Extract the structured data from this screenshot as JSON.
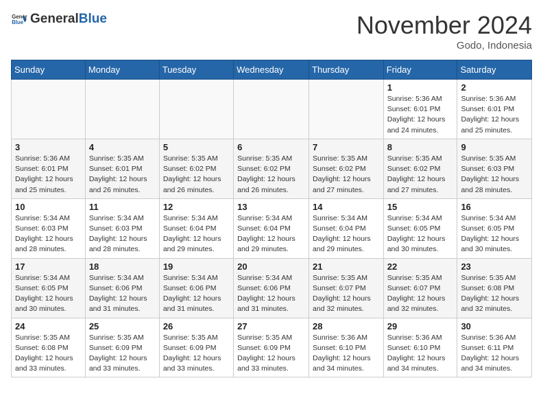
{
  "header": {
    "logo_general": "General",
    "logo_blue": "Blue",
    "month_title": "November 2024",
    "location": "Godo, Indonesia"
  },
  "weekdays": [
    "Sunday",
    "Monday",
    "Tuesday",
    "Wednesday",
    "Thursday",
    "Friday",
    "Saturday"
  ],
  "weeks": [
    [
      {
        "day": "",
        "info": ""
      },
      {
        "day": "",
        "info": ""
      },
      {
        "day": "",
        "info": ""
      },
      {
        "day": "",
        "info": ""
      },
      {
        "day": "",
        "info": ""
      },
      {
        "day": "1",
        "info": "Sunrise: 5:36 AM\nSunset: 6:01 PM\nDaylight: 12 hours and 24 minutes."
      },
      {
        "day": "2",
        "info": "Sunrise: 5:36 AM\nSunset: 6:01 PM\nDaylight: 12 hours and 25 minutes."
      }
    ],
    [
      {
        "day": "3",
        "info": "Sunrise: 5:36 AM\nSunset: 6:01 PM\nDaylight: 12 hours and 25 minutes."
      },
      {
        "day": "4",
        "info": "Sunrise: 5:35 AM\nSunset: 6:01 PM\nDaylight: 12 hours and 26 minutes."
      },
      {
        "day": "5",
        "info": "Sunrise: 5:35 AM\nSunset: 6:02 PM\nDaylight: 12 hours and 26 minutes."
      },
      {
        "day": "6",
        "info": "Sunrise: 5:35 AM\nSunset: 6:02 PM\nDaylight: 12 hours and 26 minutes."
      },
      {
        "day": "7",
        "info": "Sunrise: 5:35 AM\nSunset: 6:02 PM\nDaylight: 12 hours and 27 minutes."
      },
      {
        "day": "8",
        "info": "Sunrise: 5:35 AM\nSunset: 6:02 PM\nDaylight: 12 hours and 27 minutes."
      },
      {
        "day": "9",
        "info": "Sunrise: 5:35 AM\nSunset: 6:03 PM\nDaylight: 12 hours and 28 minutes."
      }
    ],
    [
      {
        "day": "10",
        "info": "Sunrise: 5:34 AM\nSunset: 6:03 PM\nDaylight: 12 hours and 28 minutes."
      },
      {
        "day": "11",
        "info": "Sunrise: 5:34 AM\nSunset: 6:03 PM\nDaylight: 12 hours and 28 minutes."
      },
      {
        "day": "12",
        "info": "Sunrise: 5:34 AM\nSunset: 6:04 PM\nDaylight: 12 hours and 29 minutes."
      },
      {
        "day": "13",
        "info": "Sunrise: 5:34 AM\nSunset: 6:04 PM\nDaylight: 12 hours and 29 minutes."
      },
      {
        "day": "14",
        "info": "Sunrise: 5:34 AM\nSunset: 6:04 PM\nDaylight: 12 hours and 29 minutes."
      },
      {
        "day": "15",
        "info": "Sunrise: 5:34 AM\nSunset: 6:05 PM\nDaylight: 12 hours and 30 minutes."
      },
      {
        "day": "16",
        "info": "Sunrise: 5:34 AM\nSunset: 6:05 PM\nDaylight: 12 hours and 30 minutes."
      }
    ],
    [
      {
        "day": "17",
        "info": "Sunrise: 5:34 AM\nSunset: 6:05 PM\nDaylight: 12 hours and 30 minutes."
      },
      {
        "day": "18",
        "info": "Sunrise: 5:34 AM\nSunset: 6:06 PM\nDaylight: 12 hours and 31 minutes."
      },
      {
        "day": "19",
        "info": "Sunrise: 5:34 AM\nSunset: 6:06 PM\nDaylight: 12 hours and 31 minutes."
      },
      {
        "day": "20",
        "info": "Sunrise: 5:34 AM\nSunset: 6:06 PM\nDaylight: 12 hours and 31 minutes."
      },
      {
        "day": "21",
        "info": "Sunrise: 5:35 AM\nSunset: 6:07 PM\nDaylight: 12 hours and 32 minutes."
      },
      {
        "day": "22",
        "info": "Sunrise: 5:35 AM\nSunset: 6:07 PM\nDaylight: 12 hours and 32 minutes."
      },
      {
        "day": "23",
        "info": "Sunrise: 5:35 AM\nSunset: 6:08 PM\nDaylight: 12 hours and 32 minutes."
      }
    ],
    [
      {
        "day": "24",
        "info": "Sunrise: 5:35 AM\nSunset: 6:08 PM\nDaylight: 12 hours and 33 minutes."
      },
      {
        "day": "25",
        "info": "Sunrise: 5:35 AM\nSunset: 6:09 PM\nDaylight: 12 hours and 33 minutes."
      },
      {
        "day": "26",
        "info": "Sunrise: 5:35 AM\nSunset: 6:09 PM\nDaylight: 12 hours and 33 minutes."
      },
      {
        "day": "27",
        "info": "Sunrise: 5:35 AM\nSunset: 6:09 PM\nDaylight: 12 hours and 33 minutes."
      },
      {
        "day": "28",
        "info": "Sunrise: 5:36 AM\nSunset: 6:10 PM\nDaylight: 12 hours and 34 minutes."
      },
      {
        "day": "29",
        "info": "Sunrise: 5:36 AM\nSunset: 6:10 PM\nDaylight: 12 hours and 34 minutes."
      },
      {
        "day": "30",
        "info": "Sunrise: 5:36 AM\nSunset: 6:11 PM\nDaylight: 12 hours and 34 minutes."
      }
    ]
  ]
}
